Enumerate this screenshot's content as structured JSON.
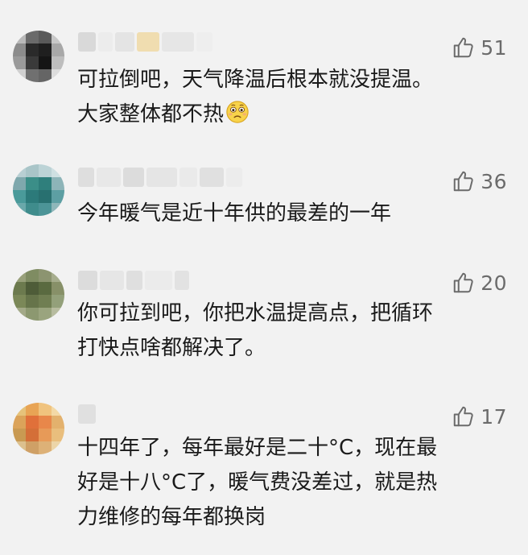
{
  "comments": [
    {
      "likes": "51",
      "lines": [
        "可拉倒吧，天气降温后根本就没提温。",
        "大家整体都不热"
      ],
      "emoji": "woozy-face-icon"
    },
    {
      "likes": "36",
      "lines": [
        "今年暖气是近十年供的最差的一年"
      ]
    },
    {
      "likes": "20",
      "lines": [
        "你可拉到吧，你把水温提高点，把循环",
        "打快点啥都解决了。"
      ]
    },
    {
      "likes": "17",
      "lines": [
        "十四年了，每年最好是二十°C，现在最",
        "好是十八°C了，暖气费没差过，就是热",
        "力维修的每年都换岗"
      ]
    }
  ],
  "colors": {
    "background": "#f2f2f2",
    "text": "#1a1a1a",
    "like": "#6b6b6b"
  },
  "icons": {
    "like": "thumbs-up-outline-icon"
  }
}
